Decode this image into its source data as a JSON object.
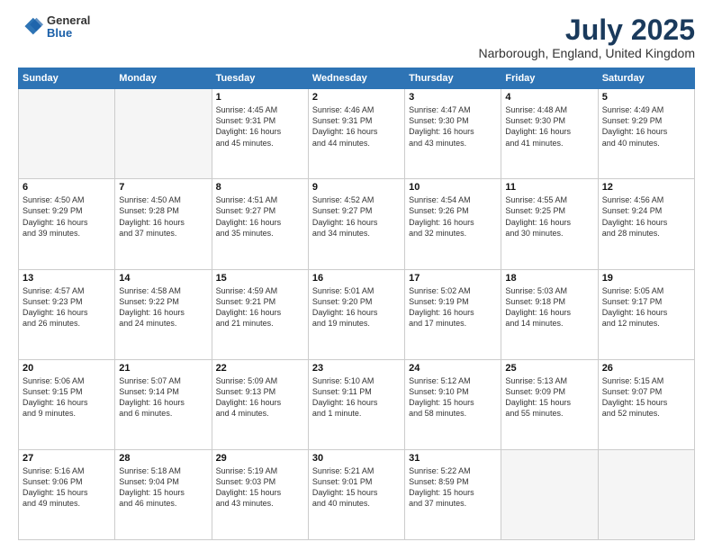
{
  "logo": {
    "general": "General",
    "blue": "Blue"
  },
  "title": {
    "month_year": "July 2025",
    "location": "Narborough, England, United Kingdom"
  },
  "weekdays": [
    "Sunday",
    "Monday",
    "Tuesday",
    "Wednesday",
    "Thursday",
    "Friday",
    "Saturday"
  ],
  "weeks": [
    [
      {
        "day": "",
        "info": ""
      },
      {
        "day": "",
        "info": ""
      },
      {
        "day": "1",
        "info": "Sunrise: 4:45 AM\nSunset: 9:31 PM\nDaylight: 16 hours\nand 45 minutes."
      },
      {
        "day": "2",
        "info": "Sunrise: 4:46 AM\nSunset: 9:31 PM\nDaylight: 16 hours\nand 44 minutes."
      },
      {
        "day": "3",
        "info": "Sunrise: 4:47 AM\nSunset: 9:30 PM\nDaylight: 16 hours\nand 43 minutes."
      },
      {
        "day": "4",
        "info": "Sunrise: 4:48 AM\nSunset: 9:30 PM\nDaylight: 16 hours\nand 41 minutes."
      },
      {
        "day": "5",
        "info": "Sunrise: 4:49 AM\nSunset: 9:29 PM\nDaylight: 16 hours\nand 40 minutes."
      }
    ],
    [
      {
        "day": "6",
        "info": "Sunrise: 4:50 AM\nSunset: 9:29 PM\nDaylight: 16 hours\nand 39 minutes."
      },
      {
        "day": "7",
        "info": "Sunrise: 4:50 AM\nSunset: 9:28 PM\nDaylight: 16 hours\nand 37 minutes."
      },
      {
        "day": "8",
        "info": "Sunrise: 4:51 AM\nSunset: 9:27 PM\nDaylight: 16 hours\nand 35 minutes."
      },
      {
        "day": "9",
        "info": "Sunrise: 4:52 AM\nSunset: 9:27 PM\nDaylight: 16 hours\nand 34 minutes."
      },
      {
        "day": "10",
        "info": "Sunrise: 4:54 AM\nSunset: 9:26 PM\nDaylight: 16 hours\nand 32 minutes."
      },
      {
        "day": "11",
        "info": "Sunrise: 4:55 AM\nSunset: 9:25 PM\nDaylight: 16 hours\nand 30 minutes."
      },
      {
        "day": "12",
        "info": "Sunrise: 4:56 AM\nSunset: 9:24 PM\nDaylight: 16 hours\nand 28 minutes."
      }
    ],
    [
      {
        "day": "13",
        "info": "Sunrise: 4:57 AM\nSunset: 9:23 PM\nDaylight: 16 hours\nand 26 minutes."
      },
      {
        "day": "14",
        "info": "Sunrise: 4:58 AM\nSunset: 9:22 PM\nDaylight: 16 hours\nand 24 minutes."
      },
      {
        "day": "15",
        "info": "Sunrise: 4:59 AM\nSunset: 9:21 PM\nDaylight: 16 hours\nand 21 minutes."
      },
      {
        "day": "16",
        "info": "Sunrise: 5:01 AM\nSunset: 9:20 PM\nDaylight: 16 hours\nand 19 minutes."
      },
      {
        "day": "17",
        "info": "Sunrise: 5:02 AM\nSunset: 9:19 PM\nDaylight: 16 hours\nand 17 minutes."
      },
      {
        "day": "18",
        "info": "Sunrise: 5:03 AM\nSunset: 9:18 PM\nDaylight: 16 hours\nand 14 minutes."
      },
      {
        "day": "19",
        "info": "Sunrise: 5:05 AM\nSunset: 9:17 PM\nDaylight: 16 hours\nand 12 minutes."
      }
    ],
    [
      {
        "day": "20",
        "info": "Sunrise: 5:06 AM\nSunset: 9:15 PM\nDaylight: 16 hours\nand 9 minutes."
      },
      {
        "day": "21",
        "info": "Sunrise: 5:07 AM\nSunset: 9:14 PM\nDaylight: 16 hours\nand 6 minutes."
      },
      {
        "day": "22",
        "info": "Sunrise: 5:09 AM\nSunset: 9:13 PM\nDaylight: 16 hours\nand 4 minutes."
      },
      {
        "day": "23",
        "info": "Sunrise: 5:10 AM\nSunset: 9:11 PM\nDaylight: 16 hours\nand 1 minute."
      },
      {
        "day": "24",
        "info": "Sunrise: 5:12 AM\nSunset: 9:10 PM\nDaylight: 15 hours\nand 58 minutes."
      },
      {
        "day": "25",
        "info": "Sunrise: 5:13 AM\nSunset: 9:09 PM\nDaylight: 15 hours\nand 55 minutes."
      },
      {
        "day": "26",
        "info": "Sunrise: 5:15 AM\nSunset: 9:07 PM\nDaylight: 15 hours\nand 52 minutes."
      }
    ],
    [
      {
        "day": "27",
        "info": "Sunrise: 5:16 AM\nSunset: 9:06 PM\nDaylight: 15 hours\nand 49 minutes."
      },
      {
        "day": "28",
        "info": "Sunrise: 5:18 AM\nSunset: 9:04 PM\nDaylight: 15 hours\nand 46 minutes."
      },
      {
        "day": "29",
        "info": "Sunrise: 5:19 AM\nSunset: 9:03 PM\nDaylight: 15 hours\nand 43 minutes."
      },
      {
        "day": "30",
        "info": "Sunrise: 5:21 AM\nSunset: 9:01 PM\nDaylight: 15 hours\nand 40 minutes."
      },
      {
        "day": "31",
        "info": "Sunrise: 5:22 AM\nSunset: 8:59 PM\nDaylight: 15 hours\nand 37 minutes."
      },
      {
        "day": "",
        "info": ""
      },
      {
        "day": "",
        "info": ""
      }
    ]
  ]
}
